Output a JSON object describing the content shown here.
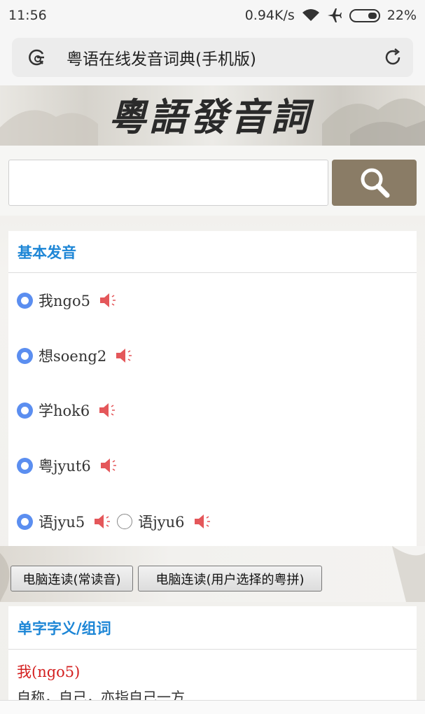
{
  "status": {
    "time": "11:56",
    "net_speed": "0.94K/s",
    "battery": "22%"
  },
  "browser": {
    "page_title": "粤语在线发音词典(手机版)"
  },
  "banner": {
    "title": "粵語發音詞典"
  },
  "search": {
    "value": "",
    "placeholder": ""
  },
  "pronunciation": {
    "header": "基本发音",
    "items": [
      {
        "label": "我ngo5"
      },
      {
        "label": "想soeng2"
      },
      {
        "label": "学hok6"
      },
      {
        "label": "粤jyut6"
      },
      {
        "label": "语jyu5",
        "alt_label": "语jyu6"
      }
    ]
  },
  "actions": {
    "read_common": "电脑连读(常读音)",
    "read_selected": "电脑连读(用户选择的粤拼)"
  },
  "meaning": {
    "header": "单字字义/组词",
    "entry_head": "我(ngo5)",
    "entry_text": "自称，自己，亦指自己一方"
  },
  "colors": {
    "accent": "#1d86d6",
    "radio": "#5b8ef0",
    "speaker": "#e4575a",
    "search_button": "#8a7c66",
    "entry_head": "#d42020"
  }
}
